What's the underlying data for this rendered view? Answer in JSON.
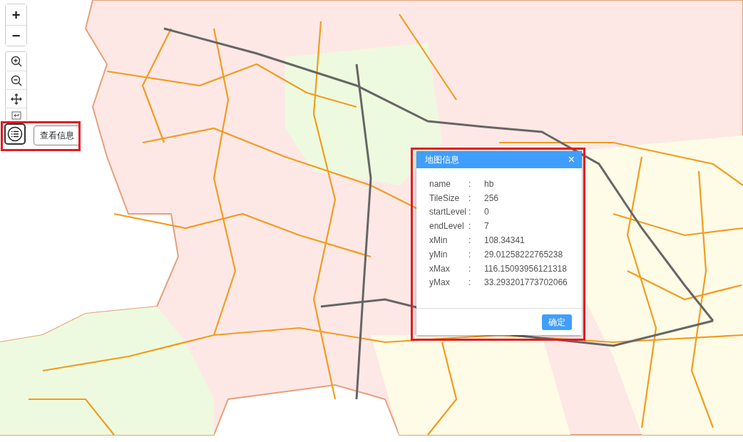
{
  "zoom_buttons": [
    {
      "label": "+"
    },
    {
      "label": "−"
    }
  ],
  "toolbar": {
    "tools": [
      {
        "kind": "zoomin"
      },
      {
        "kind": "zoomout"
      },
      {
        "kind": "pan"
      },
      {
        "kind": "back"
      }
    ],
    "active_tool": {
      "selected": true
    },
    "tooltip": "查看信息"
  },
  "dialog": {
    "title": "地图信息",
    "close": "×",
    "rows": [
      {
        "key": "name",
        "sep": ":",
        "value": "hb"
      },
      {
        "key": "TileSize",
        "sep": ":",
        "value": "256"
      },
      {
        "key": "startLevel",
        "sep": ":",
        "value": "0"
      },
      {
        "key": "endLevel",
        "sep": ":",
        "value": "7"
      },
      {
        "key": "xMin",
        "sep": ":",
        "value": "108.34341"
      },
      {
        "key": "yMin",
        "sep": ":",
        "value": "29.01258222765238"
      },
      {
        "key": "xMax",
        "sep": ":",
        "value": "116.15093956121318"
      },
      {
        "key": "yMax",
        "sep": ":",
        "value": "33.293201773702066"
      }
    ],
    "ok_button": "确定"
  }
}
